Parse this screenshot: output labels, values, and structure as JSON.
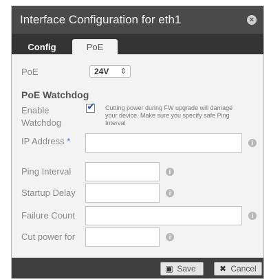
{
  "dialog": {
    "title": "Interface Configuration for eth1",
    "close_icon": "×"
  },
  "tabs": {
    "config_label": "Config",
    "poe_label": "PoE"
  },
  "poe": {
    "label": "PoE",
    "selected_value": "24V",
    "caret": "⇕"
  },
  "watchdog": {
    "heading": "PoE Watchdog",
    "enable_label": "Enable Watchdog",
    "enabled": true,
    "warning": "Cutting power during FW upgrade will damage your device. Make sure you specify safe Ping Interval"
  },
  "fields": {
    "ip_address_label": "IP Address",
    "ip_address_required_mark": "*",
    "ip_address_value": "",
    "ping_interval_label": "Ping Interval",
    "ping_interval_value": "",
    "startup_delay_label": "Startup Delay",
    "startup_delay_value": "",
    "failure_count_label": "Failure Count",
    "failure_count_value": "",
    "cut_power_label": "Cut power for",
    "cut_power_value": ""
  },
  "info_glyph": "i",
  "footer": {
    "save_label": "Save",
    "cancel_label": "Cancel",
    "save_icon": "▣",
    "cancel_icon": "✖"
  }
}
